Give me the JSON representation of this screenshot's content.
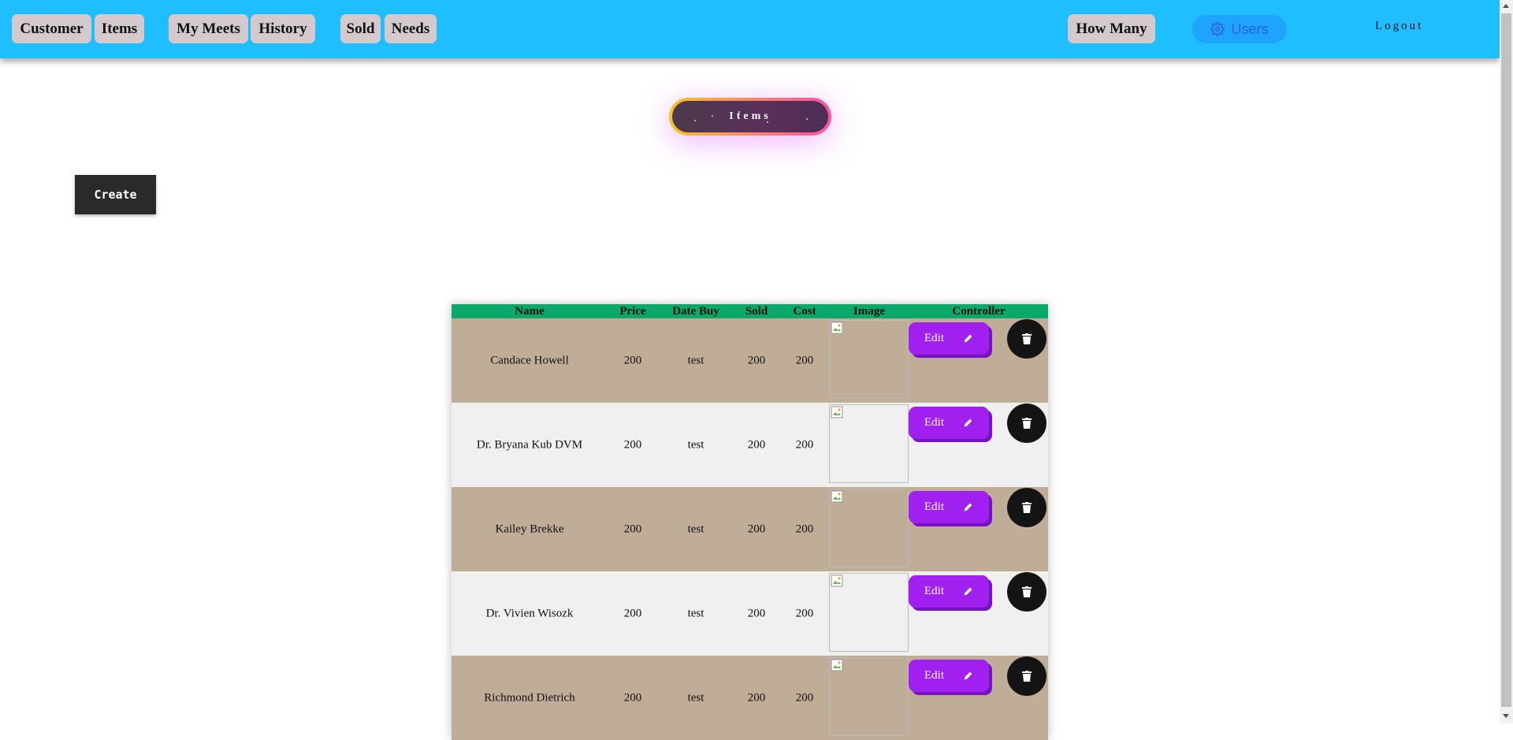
{
  "nav": {
    "customer": "Customer",
    "items": "Items",
    "my_meets": "My Meets",
    "history": "History",
    "sold": "Sold",
    "needs": "Needs",
    "how_many": "How Many",
    "users": "Users",
    "logout": "Logout",
    "users_icon": "gear-icon"
  },
  "page": {
    "title": "Items"
  },
  "actions": {
    "create": "Create"
  },
  "table": {
    "headers": [
      "Name",
      "Price",
      "Date Buy",
      "Sold",
      "Cost",
      "Image",
      "Controller"
    ],
    "edit_label": "Edit",
    "rows": [
      {
        "name": "Candace Howell",
        "price": "200",
        "date_buy": "test",
        "sold": "200",
        "cost": "200"
      },
      {
        "name": "Dr. Bryana Kub DVM",
        "price": "200",
        "date_buy": "test",
        "sold": "200",
        "cost": "200"
      },
      {
        "name": "Kailey Brekke",
        "price": "200",
        "date_buy": "test",
        "sold": "200",
        "cost": "200"
      },
      {
        "name": "Dr. Vivien Wisozk",
        "price": "200",
        "date_buy": "test",
        "sold": "200",
        "cost": "200"
      },
      {
        "name": "Richmond Dietrich",
        "price": "200",
        "date_buy": "test",
        "sold": "200",
        "cost": "200"
      }
    ]
  },
  "colors": {
    "topbar": "#1fbeff",
    "header_row": "#0aa86a",
    "row_odd": "#bfad98",
    "row_even": "#f1f0f0",
    "edit": "#a020f0",
    "delete": "#141414"
  }
}
